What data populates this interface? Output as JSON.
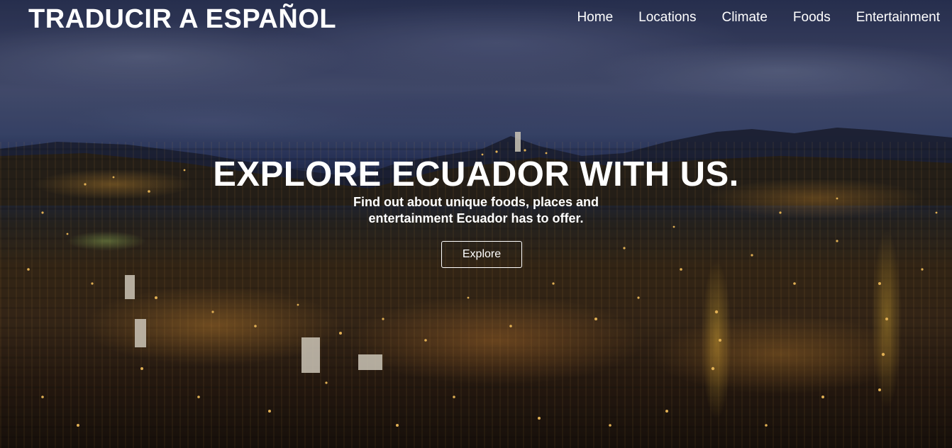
{
  "navbar": {
    "brand": "TRADUCIR A ESPAÑOL",
    "links": [
      "Home",
      "Locations",
      "Climate",
      "Foods",
      "Entertainment"
    ]
  },
  "hero": {
    "title": "EXPLORE ECUADOR WITH US.",
    "subtitle": "Find out about unique foods, places and entertainment Ecuador has to offer.",
    "button_label": "Explore",
    "background_image": "night-city-panorama"
  },
  "colors": {
    "text": "#ffffff",
    "sky": "#3a4266",
    "city_lights": "#ffb23c"
  }
}
